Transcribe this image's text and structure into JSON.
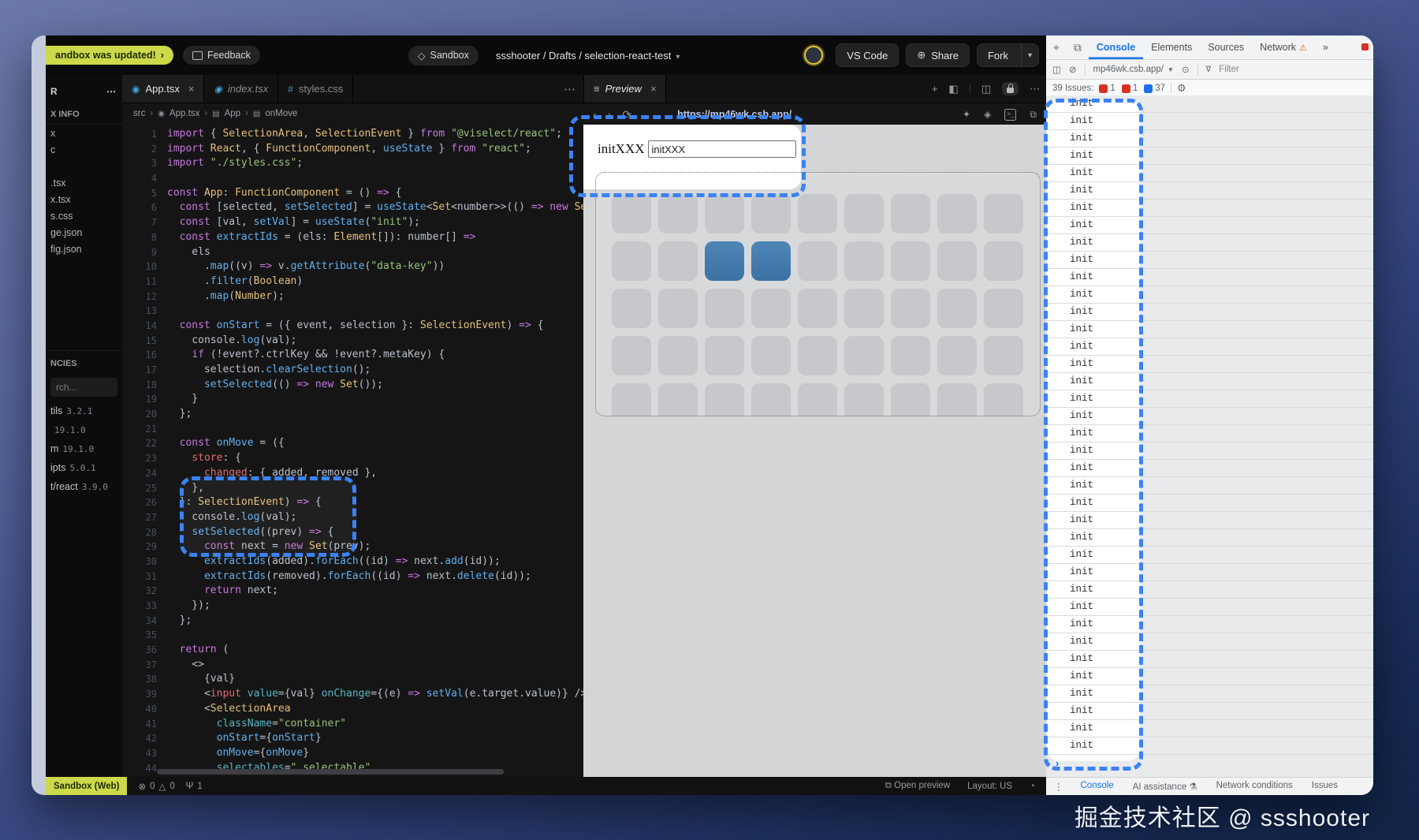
{
  "header": {
    "update_banner": "andbox was updated!",
    "update_chevron": "›",
    "feedback_label": "Feedback",
    "sandbox_chip": "Sandbox",
    "breadcrumb": "ssshooter / Drafts / selection-react-test",
    "vscode_label": "VS Code",
    "share_label": "Share",
    "fork_label": "Fork"
  },
  "sidebar": {
    "explorer_fragment": "R",
    "menu_dots": "⋯",
    "info_header": "X INFO",
    "files": [
      "x",
      "c",
      "",
      ".tsx",
      "x.tsx",
      "s.css",
      "ge.json",
      "fig.json"
    ],
    "deps_header": "NCIES",
    "search_fragment": "rch...",
    "deps": [
      {
        "n": "tils",
        "v": "3.2.1"
      },
      {
        "n": "",
        "v": "19.1.0"
      },
      {
        "n": "m",
        "v": "19.1.0"
      },
      {
        "n": "ipts",
        "v": "5.0.1"
      },
      {
        "n": "t/react",
        "v": "3.9.0"
      }
    ]
  },
  "editor": {
    "tabs": [
      {
        "label": "App.tsx",
        "active": true,
        "close": "×",
        "icon": "react"
      },
      {
        "label": "index.tsx",
        "italic": true,
        "icon": "react"
      },
      {
        "label": "styles.css",
        "icon": "css"
      }
    ],
    "overflow_menu": "⋯",
    "breadcrumb": [
      "src",
      "App.tsx",
      "App",
      "onMove"
    ],
    "code": [
      "import { SelectionArea, SelectionEvent } from \"@viselect/react\";",
      "import React, { FunctionComponent, useState } from \"react\";",
      "import \"./styles.css\";",
      "",
      "const App: FunctionComponent = () => {",
      "  const [selected, setSelected] = useState<Set<number>>(() => new Set());",
      "  const [val, setVal] = useState(\"init\");",
      "  const extractIds = (els: Element[]): number[] =>",
      "    els",
      "      .map((v) => v.getAttribute(\"data-key\"))",
      "      .filter(Boolean)",
      "      .map(Number);",
      "",
      "  const onStart = ({ event, selection }: SelectionEvent) => {",
      "    console.log(val);",
      "    if (!event?.ctrlKey && !event?.metaKey) {",
      "      selection.clearSelection();",
      "      setSelected(() => new Set());",
      "    }",
      "  };",
      "",
      "  const onMove = ({",
      "    store: {",
      "      changed: { added, removed },",
      "    },",
      "  }: SelectionEvent) => {",
      "    console.log(val);",
      "    setSelected((prev) => {",
      "      const next = new Set(prev);",
      "      extractIds(added).forEach((id) => next.add(id));",
      "      extractIds(removed).forEach((id) => next.delete(id));",
      "      return next;",
      "    });",
      "  };",
      "",
      "  return (",
      "    <>",
      "      {val}",
      "      <input value={val} onChange={(e) => setVal(e.target.value)} />",
      "      <SelectionArea",
      "        className=\"container\"",
      "        onStart={onStart}",
      "        onMove={onMove}",
      "        selectables=\".selectable\""
    ]
  },
  "preview": {
    "tab_label": "Preview",
    "tab_close": "×",
    "url": "https://mp46wk.csb.app/",
    "page_label": "initXXX",
    "input_value": "initXXX",
    "grid": {
      "rows": 5,
      "cols": 9,
      "selected": [
        [
          1,
          2
        ],
        [
          1,
          3
        ]
      ]
    }
  },
  "devtools": {
    "tabs": [
      {
        "label": "Console",
        "active": true
      },
      {
        "label": "Elements"
      },
      {
        "label": "Sources"
      },
      {
        "label": "Network",
        "warn": true
      }
    ],
    "more_tabs": "»",
    "context": "mp46wk.csb.app/",
    "filter_label": "Filter",
    "issues_text": "39 Issues:",
    "issue_badges": [
      {
        "count": "1",
        "color": "#d93025"
      },
      {
        "count": "1",
        "color": "#d93025"
      },
      {
        "count": "37",
        "color": "#1a73e8"
      }
    ],
    "log_text": "init",
    "log_count": 38,
    "prompt": "›",
    "drawer": [
      {
        "label": "Console",
        "active": true
      },
      {
        "label": "AI assistance",
        "flask": true
      },
      {
        "label": "Network conditions"
      },
      {
        "label": "Issues"
      }
    ]
  },
  "statusbar": {
    "env_label": "Sandbox (Web)",
    "errors": "0",
    "warnings": "0",
    "connections": "1",
    "open_preview": "Open preview",
    "layout": "Layout: US"
  },
  "watermark": "掘金技术社区 @ ssshooter"
}
